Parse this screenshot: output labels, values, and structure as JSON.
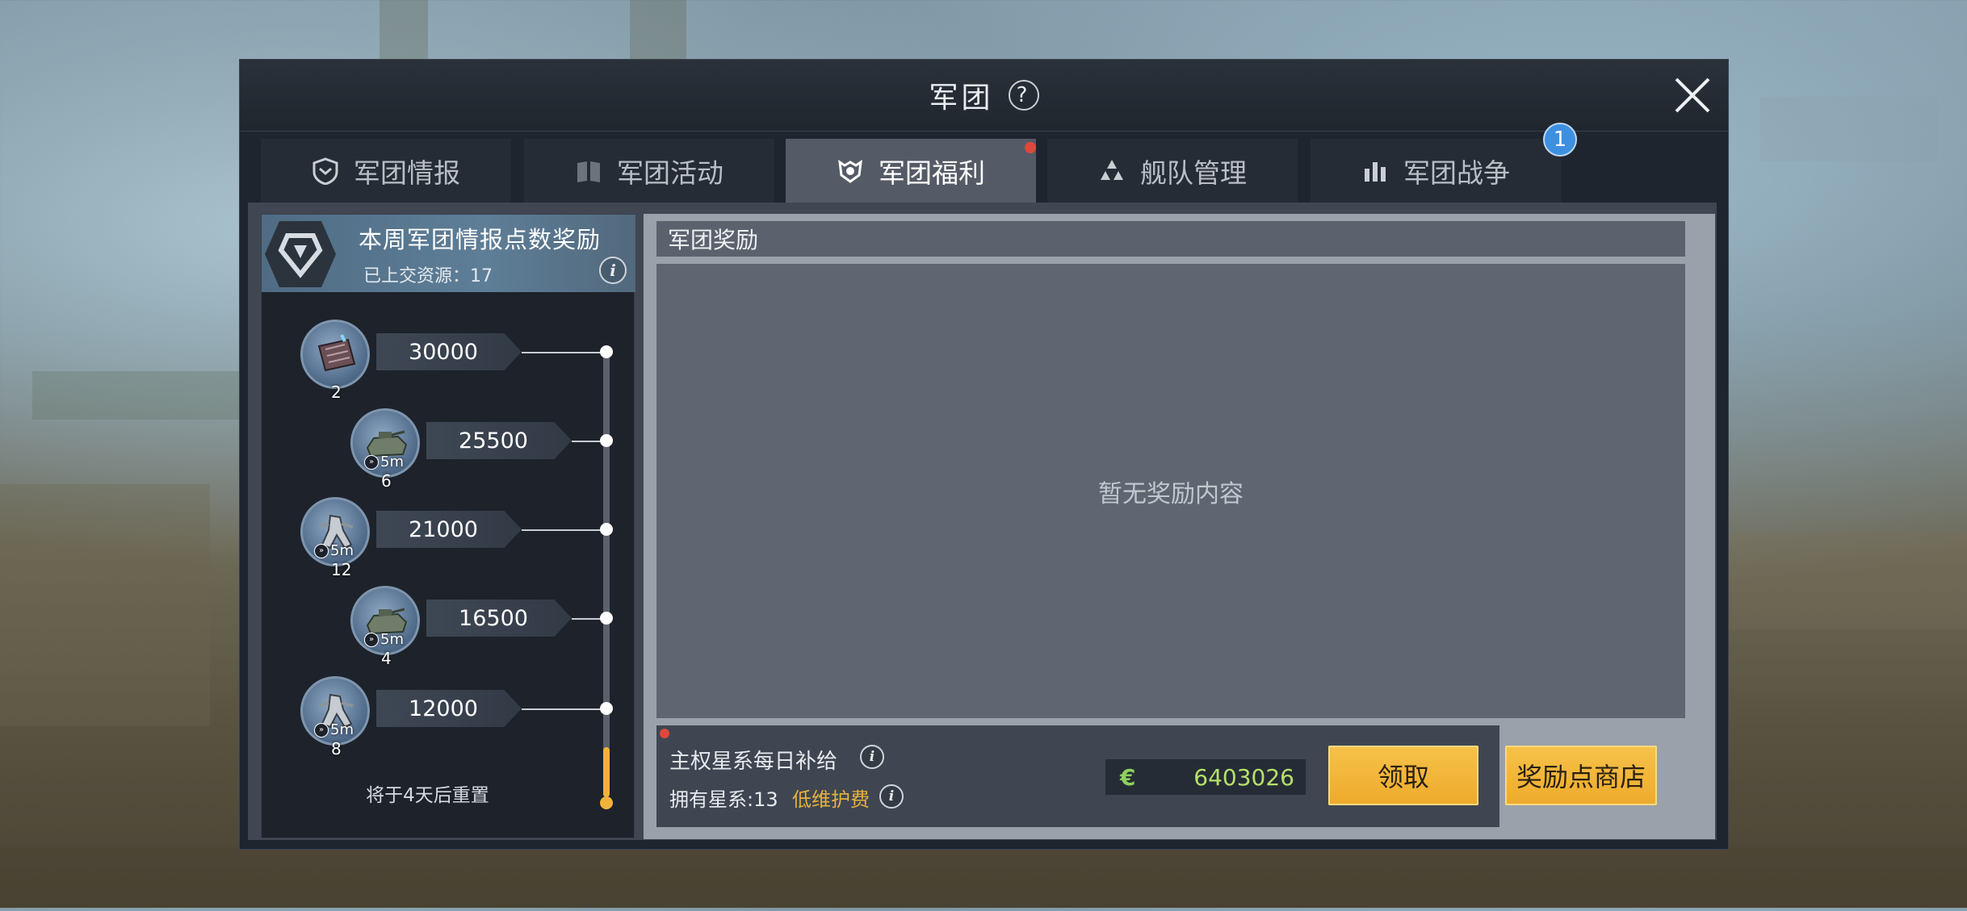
{
  "window": {
    "title": "军团",
    "help_icon": "question-icon",
    "close_icon": "close-icon"
  },
  "tabs": [
    {
      "label": "军团情报",
      "icon": "shield-icon",
      "active": false
    },
    {
      "label": "军团活动",
      "icon": "book-icon",
      "active": false
    },
    {
      "label": "军团福利",
      "icon": "emblem-icon",
      "active": true,
      "red_dot": true
    },
    {
      "label": "舰队管理",
      "icon": "fleet-icon",
      "active": false
    },
    {
      "label": "军团战争",
      "icon": "buildings-icon",
      "active": false,
      "badge": "1"
    }
  ],
  "left_panel": {
    "title": "本周军团情报点数奖励",
    "submitted": "已上交资源：17",
    "tiers": [
      {
        "points": "30000",
        "count": "2",
        "tag": "",
        "item_icon": "blueprint-icon"
      },
      {
        "points": "25500",
        "count": "6",
        "tag": "5m",
        "item_icon": "tank-icon"
      },
      {
        "points": "21000",
        "count": "12",
        "tag": "5m",
        "item_icon": "mech-icon"
      },
      {
        "points": "16500",
        "count": "4",
        "tag": "5m",
        "item_icon": "tank-icon"
      },
      {
        "points": "12000",
        "count": "8",
        "tag": "5m",
        "item_icon": "mech-icon"
      }
    ],
    "progress_fraction": 0.1,
    "reset_text": "将于4天后重置"
  },
  "right_panel": {
    "header": "军团奖励",
    "empty_text": "暂无奖励内容",
    "sovereign_label": "主权星系每日补给",
    "owned_systems": "拥有星系:13",
    "upkeep_label": "低维护费",
    "currency_icon": "€",
    "currency_value": "6403026",
    "claim_button": "领取",
    "shop_button": "奖励点商店"
  },
  "colors": {
    "accent_yellow": "#f1b23b",
    "badge_blue": "#3d8fe0",
    "notice_red": "#e0473c",
    "currency_green": "#b6e06b"
  }
}
